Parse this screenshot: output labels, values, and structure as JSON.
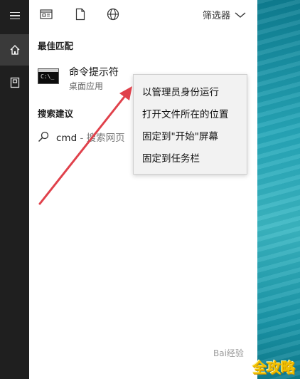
{
  "topbar": {
    "icons": [
      "document-list-icon",
      "file-icon",
      "globe-icon"
    ],
    "filter_label": "筛选器"
  },
  "best_match": {
    "section_label": "最佳匹配",
    "title": "命令提示符",
    "subtitle": "桌面应用"
  },
  "search_suggestions": {
    "section_label": "搜索建议",
    "item_text": "cmd",
    "item_suffix": " - 搜索网页"
  },
  "context_menu": {
    "items": [
      "以管理员身份运行",
      "打开文件所在的位置",
      "固定到\"开始\"屏幕",
      "固定到任务栏"
    ]
  },
  "watermark": {
    "text": "Bai经验",
    "brand_text": "全攻略"
  },
  "colors": {
    "rail": "#1f1f1f",
    "arrow": "#e0414b",
    "desktop": "#26a7b9"
  }
}
